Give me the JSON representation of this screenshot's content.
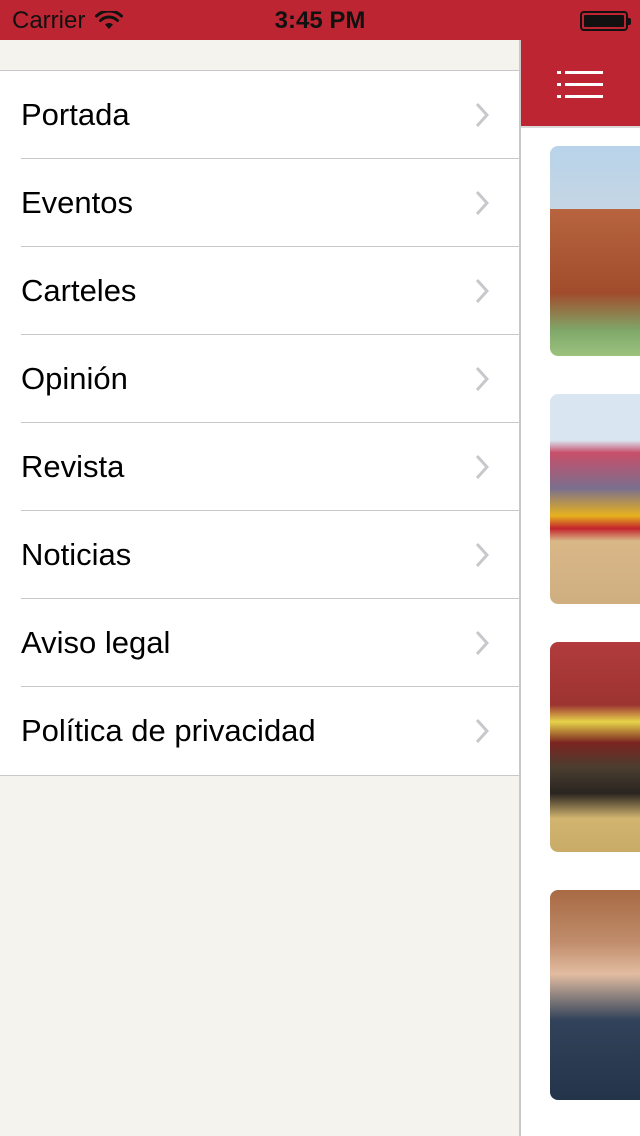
{
  "status_bar": {
    "carrier": "Carrier",
    "time": "3:45 PM"
  },
  "colors": {
    "brand_red": "#bd2532",
    "menu_background": "#f4f3ed",
    "chevron": "#c7c7cc"
  },
  "menu": {
    "items": [
      {
        "label": "Portada"
      },
      {
        "label": "Eventos"
      },
      {
        "label": "Carteles"
      },
      {
        "label": "Opinión"
      },
      {
        "label": "Revista"
      },
      {
        "label": "Noticias"
      },
      {
        "label": "Aviso legal"
      },
      {
        "label": "Política de privacidad"
      }
    ]
  },
  "content": {
    "nav_icon": "hamburger-menu-icon",
    "thumbnails": [
      {
        "subject": "bullring-building"
      },
      {
        "subject": "bullring-crowd"
      },
      {
        "subject": "bull-in-arena"
      },
      {
        "subject": "man-in-suit"
      }
    ]
  }
}
